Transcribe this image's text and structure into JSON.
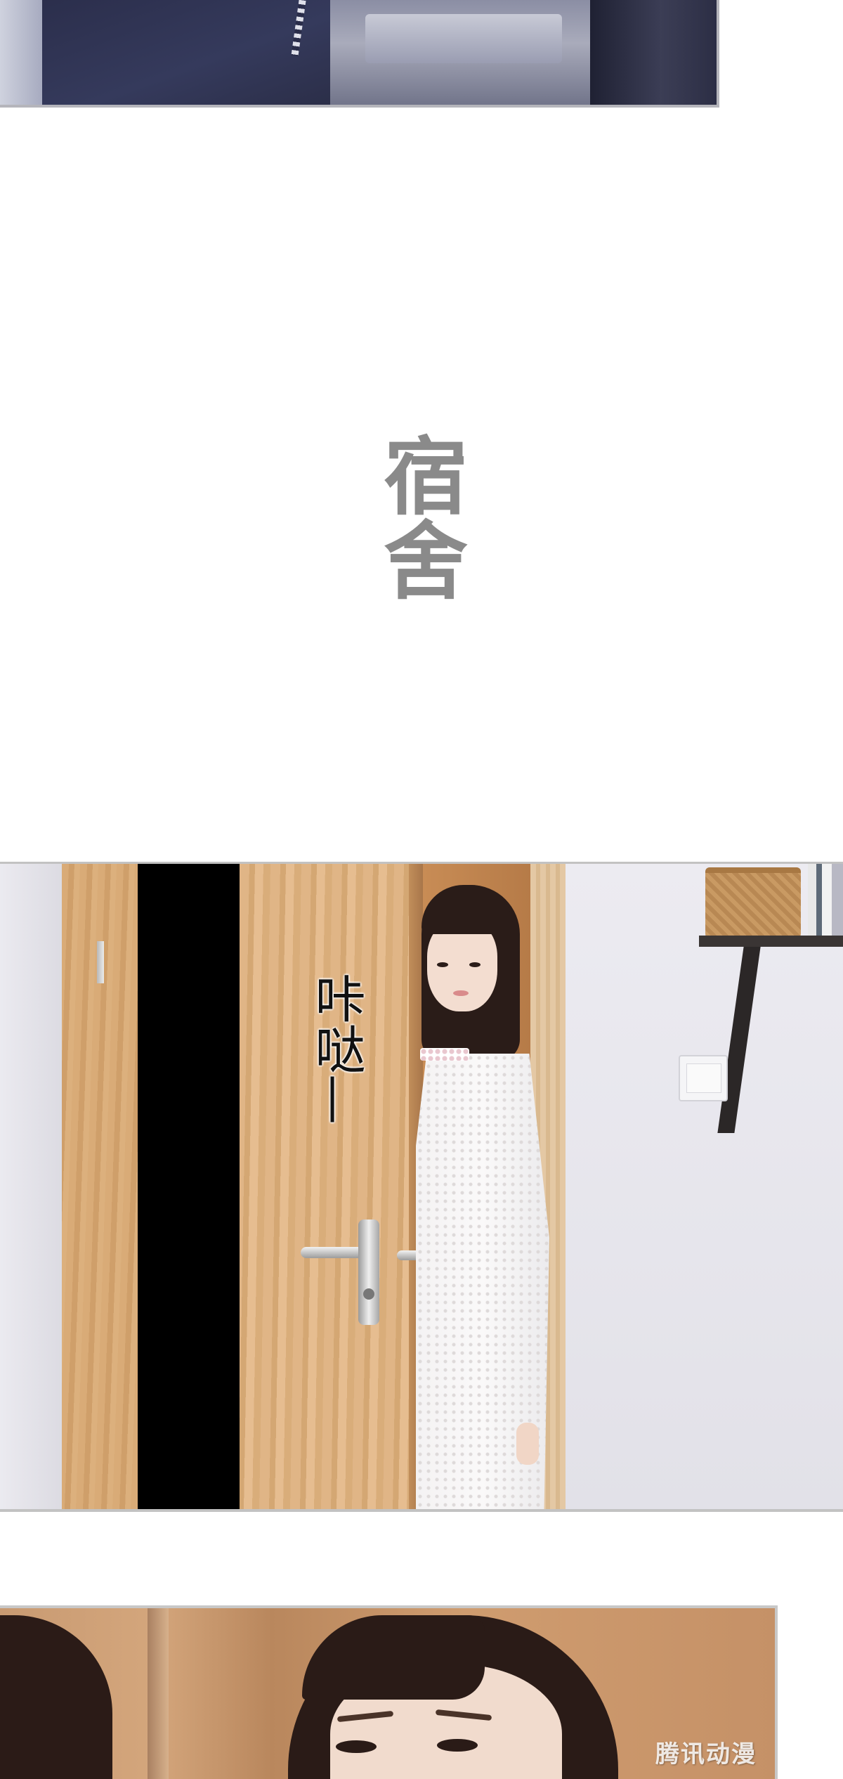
{
  "scene": {
    "title": "宿舍"
  },
  "panels": [
    {
      "name": "car-interior"
    },
    {
      "name": "dorm-door",
      "sound_effect": "咔哒—"
    },
    {
      "name": "close-up-face"
    }
  ],
  "watermark": {
    "text": "腾讯动漫"
  }
}
